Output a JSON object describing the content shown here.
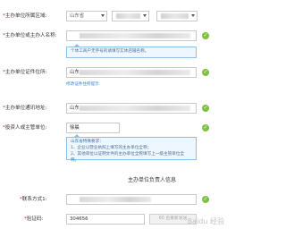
{
  "region": {
    "label": "主办单位所属区域:",
    "province_value": "山东省"
  },
  "unit_name": {
    "label": "主办单位或主办人名称:",
    "hint": "个体工商户无字号的请填写实体店铺名称。"
  },
  "cert_address": {
    "label": "主办单位证件住所:",
    "value_prefix": "山东",
    "link": "修改证件住所提示"
  },
  "contact_address": {
    "label": "主办单位通讯地址:",
    "value_prefix": "山东"
  },
  "investor": {
    "label": "投资人或主管单位:",
    "value": "徐晨",
    "hint_lines": [
      "山东省特殊要求：",
      "1、企业以营业执照上填写的主办单位全称；",
      "2、其他单位以证明文件的主办单位全称填写上一级主管单位全称。"
    ]
  },
  "responsible_section": {
    "title": "主办单位负责人信息"
  },
  "contact_method": {
    "label": "联系方式1:"
  },
  "verification": {
    "label": "验证码:",
    "value": "304656",
    "button": "60 后重新发送"
  },
  "colors": {
    "required": "#e02020",
    "check": "#7cc142",
    "link": "#2d7fd3",
    "hint_border": "#8ec0e8",
    "hint_bg": "#eef6ff"
  },
  "watermark": "Baidu 经验"
}
